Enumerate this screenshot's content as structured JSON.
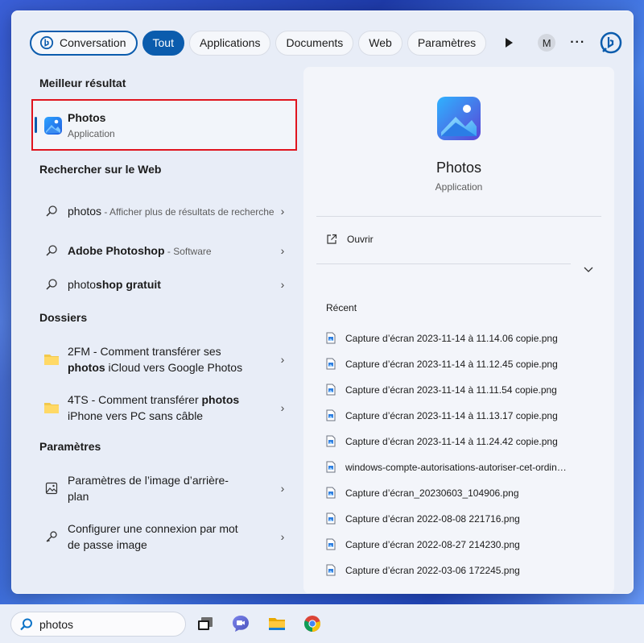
{
  "filters": {
    "conversation": "Conversation",
    "tout": "Tout",
    "applications": "Applications",
    "documents": "Documents",
    "web": "Web",
    "parametres": "Paramètres",
    "avatar_initial": "M",
    "more": "···"
  },
  "best_match": {
    "heading": "Meilleur résultat",
    "title": "Photos",
    "subtitle": "Application"
  },
  "web": {
    "heading": "Rechercher sur le Web",
    "items": [
      {
        "bold": "",
        "normal": "photos",
        "extra": " - Afficher plus de résultats de recherche"
      },
      {
        "bold": "Adobe Photoshop",
        "normal": "",
        "extra": " - Software"
      },
      {
        "bold": "",
        "normal": "photoshop gratuit",
        "extra": ""
      }
    ]
  },
  "folders": {
    "heading": "Dossiers",
    "items": [
      {
        "line1": "2FM - Comment transférer ses",
        "bold": "photos",
        "line2_rest": " iCloud vers Google Photos"
      },
      {
        "line1_pre": "4TS - Comment transférer ",
        "line1_bold": "photos",
        "line2": "iPhone vers PC sans câble"
      }
    ]
  },
  "settings": {
    "heading": "Paramètres",
    "items": [
      {
        "line1": "Paramètres de l’image d’arrière-",
        "line2": "plan"
      },
      {
        "line1": "Configurer une connexion par mot",
        "line2": "de passe image"
      }
    ]
  },
  "preview": {
    "title": "Photos",
    "subtitle": "Application",
    "open_label": "Ouvrir",
    "recent_heading": "Récent",
    "recent_files": [
      "Capture d’écran 2023-11-14 à 11.14.06 copie.png",
      "Capture d’écran 2023-11-14 à 11.12.45 copie.png",
      "Capture d’écran 2023-11-14 à 11.11.54 copie.png",
      "Capture d’écran 2023-11-14 à 11.13.17 copie.png",
      "Capture d’écran 2023-11-14 à 11.24.42 copie.png",
      "windows-compte-autorisations-autoriser-cet-ordin…",
      "Capture d’écran_20230603_104906.png",
      "Capture d’écran 2022-08-08 221716.png",
      "Capture d’écran 2022-08-27 214230.png",
      "Capture d’écran 2022-03-06 172245.png"
    ]
  },
  "taskbar": {
    "search_value": "photos"
  },
  "colors": {
    "accent": "#0b5cad",
    "highlight_box": "#e0141e"
  }
}
